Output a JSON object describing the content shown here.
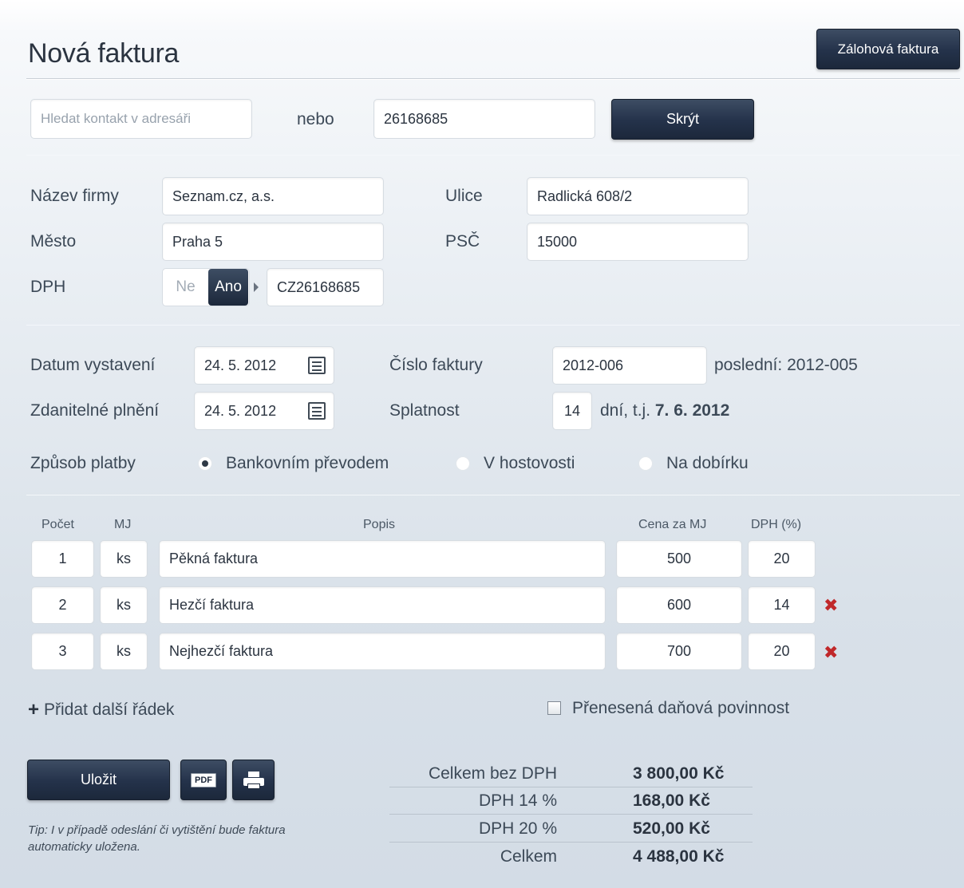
{
  "header": {
    "title": "Nová faktura",
    "advance_invoice_button": "Zálohová faktura"
  },
  "search": {
    "placeholder": "Hledat kontakt v adresáři",
    "or_label": "nebo",
    "ico_value": "26168685",
    "hide_button": "Skrýt"
  },
  "company": {
    "name_label": "Název firmy",
    "name_value": "Seznam.cz, a.s.",
    "street_label": "Ulice",
    "street_value": "Radlická 608/2",
    "city_label": "Město",
    "city_value": "Praha 5",
    "zip_label": "PSČ",
    "zip_value": "15000",
    "vat_label": "DPH",
    "vat_no": "Ne",
    "vat_yes": "Ano",
    "vat_value": "CZ26168685"
  },
  "dates": {
    "issue_label": "Datum vystavení",
    "issue_value": "24. 5. 2012",
    "taxable_label": "Zdanitelné plnění",
    "taxable_value": "24. 5. 2012",
    "invoice_no_label": "Číslo faktury",
    "invoice_no_value": "2012-006",
    "last_invoice": "poslední: 2012-005",
    "due_label": "Splatnost",
    "due_days": "14",
    "due_text": "dní, t.j.",
    "due_date": "7. 6. 2012"
  },
  "payment": {
    "label": "Způsob platby",
    "options": [
      "Bankovním převodem",
      "V hostovosti",
      "Na dobírku"
    ],
    "selected": "Bankovním převodem"
  },
  "items": {
    "headers": {
      "count": "Počet",
      "unit": "MJ",
      "description": "Popis",
      "price": "Cena za MJ",
      "vat": "DPH (%)"
    },
    "rows": [
      {
        "count": "1",
        "unit": "ks",
        "description": "Pěkná faktura",
        "price": "500",
        "vat": "20"
      },
      {
        "count": "2",
        "unit": "ks",
        "description": "Hezčí faktura",
        "price": "600",
        "vat": "14"
      },
      {
        "count": "3",
        "unit": "ks",
        "description": "Nejhezčí faktura",
        "price": "700",
        "vat": "20"
      }
    ],
    "add_row": "Přidat další řádek",
    "reverse_charge": "Přenesená daňová povinnost"
  },
  "actions": {
    "save": "Uložit",
    "pdf": "PDF",
    "tip": "Tip: I v případě odeslání či vytištění bude faktura automaticky uložena."
  },
  "summary": {
    "rows": [
      {
        "label": "Celkem bez DPH",
        "value": "3 800,00 Kč"
      },
      {
        "label": "DPH 14 %",
        "value": "168,00 Kč"
      },
      {
        "label": "DPH 20 %",
        "value": "520,00 Kč"
      },
      {
        "label": "Celkem",
        "value": "4 488,00 Kč"
      }
    ]
  },
  "colors": {
    "dark_button": "#24324a",
    "delete_icon": "#c0282a",
    "text": "#3c4957"
  }
}
